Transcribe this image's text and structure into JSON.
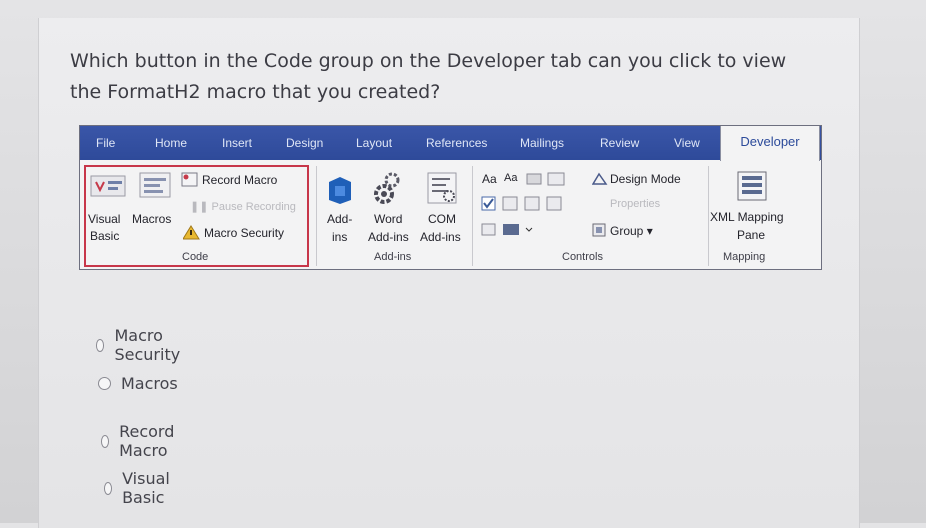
{
  "question": "Which button in the Code group on the Developer tab can you click to view the FormatH2 macro that you created?",
  "ribbon": {
    "tabs": [
      {
        "label": "File"
      },
      {
        "label": "Home"
      },
      {
        "label": "Insert"
      },
      {
        "label": "Design"
      },
      {
        "label": "Layout"
      },
      {
        "label": "References"
      },
      {
        "label": "Mailings"
      },
      {
        "label": "Review"
      },
      {
        "label": "View"
      },
      {
        "label": "Developer",
        "active": true
      }
    ],
    "code": {
      "visual_basic_1": "Visual",
      "visual_basic_2": "Basic",
      "macros": "Macros",
      "record_macro": "Record Macro",
      "pause_recording": "Pause Recording",
      "macro_security": "Macro Security",
      "group_label": "Code"
    },
    "addins": {
      "addins_1": "Add-",
      "addins_2": "ins",
      "word_1": "Word",
      "word_2": "Add-ins",
      "com_1": "COM",
      "com_2": "Add-ins",
      "group_label": "Add-ins"
    },
    "controls": {
      "aa1": "Aa",
      "aa2": "Aa",
      "design_mode": "Design Mode",
      "properties": "Properties",
      "group": "Group",
      "group_label": "Controls"
    },
    "mapping": {
      "xml_1": "XML Mapping",
      "xml_2": "Pane",
      "group_label": "Mapping"
    }
  },
  "options": [
    {
      "label": "Macro Security"
    },
    {
      "label": "Macros"
    },
    {
      "label": "Record Macro"
    },
    {
      "label": "Visual Basic"
    }
  ],
  "colors": {
    "tab_bar": "#2e4a9a",
    "highlight_border": "#c7364a",
    "active_tab_text": "#2b4a9a"
  }
}
